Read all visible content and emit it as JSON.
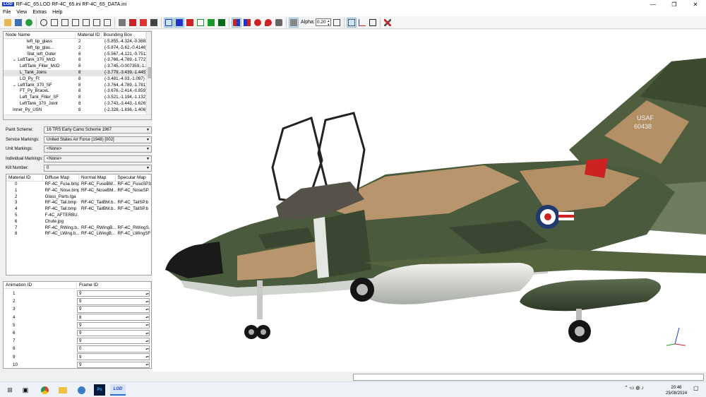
{
  "window": {
    "app_icon": "LOD",
    "title": "RF-4C_65.LOD  RF-4C_65.ini  RF-4C_65_DATA.ini",
    "minimize": "—",
    "maximize": "❐",
    "close": "✕"
  },
  "menu": [
    "File",
    "View",
    "Extras",
    "Help"
  ],
  "toolbar": {
    "alpha_label": "Alpha:",
    "alpha_value": "0.20"
  },
  "node_tree": {
    "headers": [
      "Node Name",
      "Material ID",
      "Bounding Box"
    ],
    "rows": [
      {
        "name": "left_tip_glass",
        "indent": 3,
        "mid": "2",
        "bbox": "(-5.855,-4.324,-0.3883",
        "sel": false,
        "exp": ""
      },
      {
        "name": "left_tip_glas...",
        "indent": 3,
        "mid": "2",
        "bbox": "(-5.874,-5.62,-0.4146)",
        "sel": false,
        "exp": ""
      },
      {
        "name": "Slat_left_Outer",
        "indent": 3,
        "mid": "8",
        "bbox": "(-5.567,-4.121,-0.7511",
        "sel": false,
        "exp": ""
      },
      {
        "name": "LeftTank_370_McD",
        "indent": 1,
        "mid": "8",
        "bbox": "(-3.766,-4.789,-1.772)",
        "sel": false,
        "exp": "⌄"
      },
      {
        "name": "LeftTank_Filler_McD",
        "indent": 2,
        "mid": "8",
        "bbox": "(-3.745,-0.007359,-1.3",
        "sel": false,
        "exp": ""
      },
      {
        "name": "L_Tank_Joins",
        "indent": 2,
        "mid": "8",
        "bbox": "(-3.779,-3.439,-1.445)",
        "sel": true,
        "exp": ""
      },
      {
        "name": "LO_Py_Ft",
        "indent": 2,
        "mid": "8",
        "bbox": "(-3.481,-4.03,-1.097) (",
        "sel": false,
        "exp": ""
      },
      {
        "name": "LeftTank_370_SF",
        "indent": 1,
        "mid": "8",
        "bbox": "(-3.764,-4.789,-1.781)",
        "sel": false,
        "exp": "⌄"
      },
      {
        "name": "FT_Py_BraceL",
        "indent": 2,
        "mid": "8",
        "bbox": "(-3.676,-2.414,-0.859)",
        "sel": false,
        "exp": ""
      },
      {
        "name": "Left_Tank_Filler_SF",
        "indent": 2,
        "mid": "8",
        "bbox": "(-3.521,-1.194,-1.132)",
        "sel": false,
        "exp": ""
      },
      {
        "name": "LeftTank_370_Joint",
        "indent": 2,
        "mid": "8",
        "bbox": "(-3.743,-3.443,-1.626)",
        "sel": false,
        "exp": ""
      },
      {
        "name": "Inner_Py_USN",
        "indent": 1,
        "mid": "8",
        "bbox": "(-2.328,-1.836,-1.406)",
        "sel": false,
        "exp": ""
      }
    ]
  },
  "form": {
    "paint_scheme": {
      "label": "Paint Scheme:",
      "value": "16 TRS Early Camo Scheme 1967"
    },
    "service_markings": {
      "label": "Service Markings:",
      "value": "United States Air Force (1948) [002]"
    },
    "unit_markings": {
      "label": "Unit Markings:",
      "value": "<None>"
    },
    "individual_markings": {
      "label": "Individual Markings:",
      "value": "<None>"
    },
    "kill_number": {
      "label": "Kill Number:",
      "value": "0"
    }
  },
  "materials": {
    "headers": [
      "Material ID",
      "Diffuse Map",
      "Normal Map",
      "Specular Map"
    ],
    "rows": [
      [
        "0",
        "RF-4C_Fuse.bmp",
        "RF-4C_FuseBM...",
        "RF-4C_FuseSP.b"
      ],
      [
        "1",
        "RF-4C_Nose.bmp",
        "RF-4C_NoseBM...",
        "RF-4C_NoseSP."
      ],
      [
        "2",
        "Glass_Parts.tga",
        "",
        ""
      ],
      [
        "3",
        "RF-4C_Tail.bmp",
        "RF-4C_TailBM.b...",
        "RF-4C_TailSP.b"
      ],
      [
        "4",
        "RF-4C_Tail.bmp",
        "RF-4C_TailBM.b...",
        "RF-4C_TailSP.b"
      ],
      [
        "5",
        "F-4C_AFTERBU...",
        "",
        ""
      ],
      [
        "6",
        "Chute.jpg",
        "",
        ""
      ],
      [
        "7",
        "RF-4C_RWing.b...",
        "RF-4C_RWingB...",
        "RF-4C_RWingS."
      ],
      [
        "8",
        "RF-4C_LWing.b...",
        "RF-4C_LWingB...",
        "RF-4C_LWingSF"
      ]
    ]
  },
  "animations": {
    "headers": [
      "Animation ID",
      "Frame ID"
    ],
    "rows": [
      {
        "id": "1",
        "frame": "9"
      },
      {
        "id": "2",
        "frame": "9"
      },
      {
        "id": "3",
        "frame": "9"
      },
      {
        "id": "4",
        "frame": "8"
      },
      {
        "id": "5",
        "frame": "9"
      },
      {
        "id": "6",
        "frame": "9"
      },
      {
        "id": "7",
        "frame": "9"
      },
      {
        "id": "8",
        "frame": "0"
      },
      {
        "id": "9",
        "frame": "9"
      },
      {
        "id": "10",
        "frame": "9"
      }
    ]
  },
  "aircraft": {
    "tail_text_1": "USAF",
    "tail_text_2": "60438",
    "colors": {
      "green": "#4a5a3c",
      "tan": "#b8956c",
      "dark_green": "#3a4630",
      "belly": "#d8dcd8",
      "nose": "#1a1a1a"
    }
  },
  "taskbar": {
    "time": "20:46",
    "date": "25/08/2024",
    "lod_label": "LOD",
    "ps_label": "Ps"
  }
}
